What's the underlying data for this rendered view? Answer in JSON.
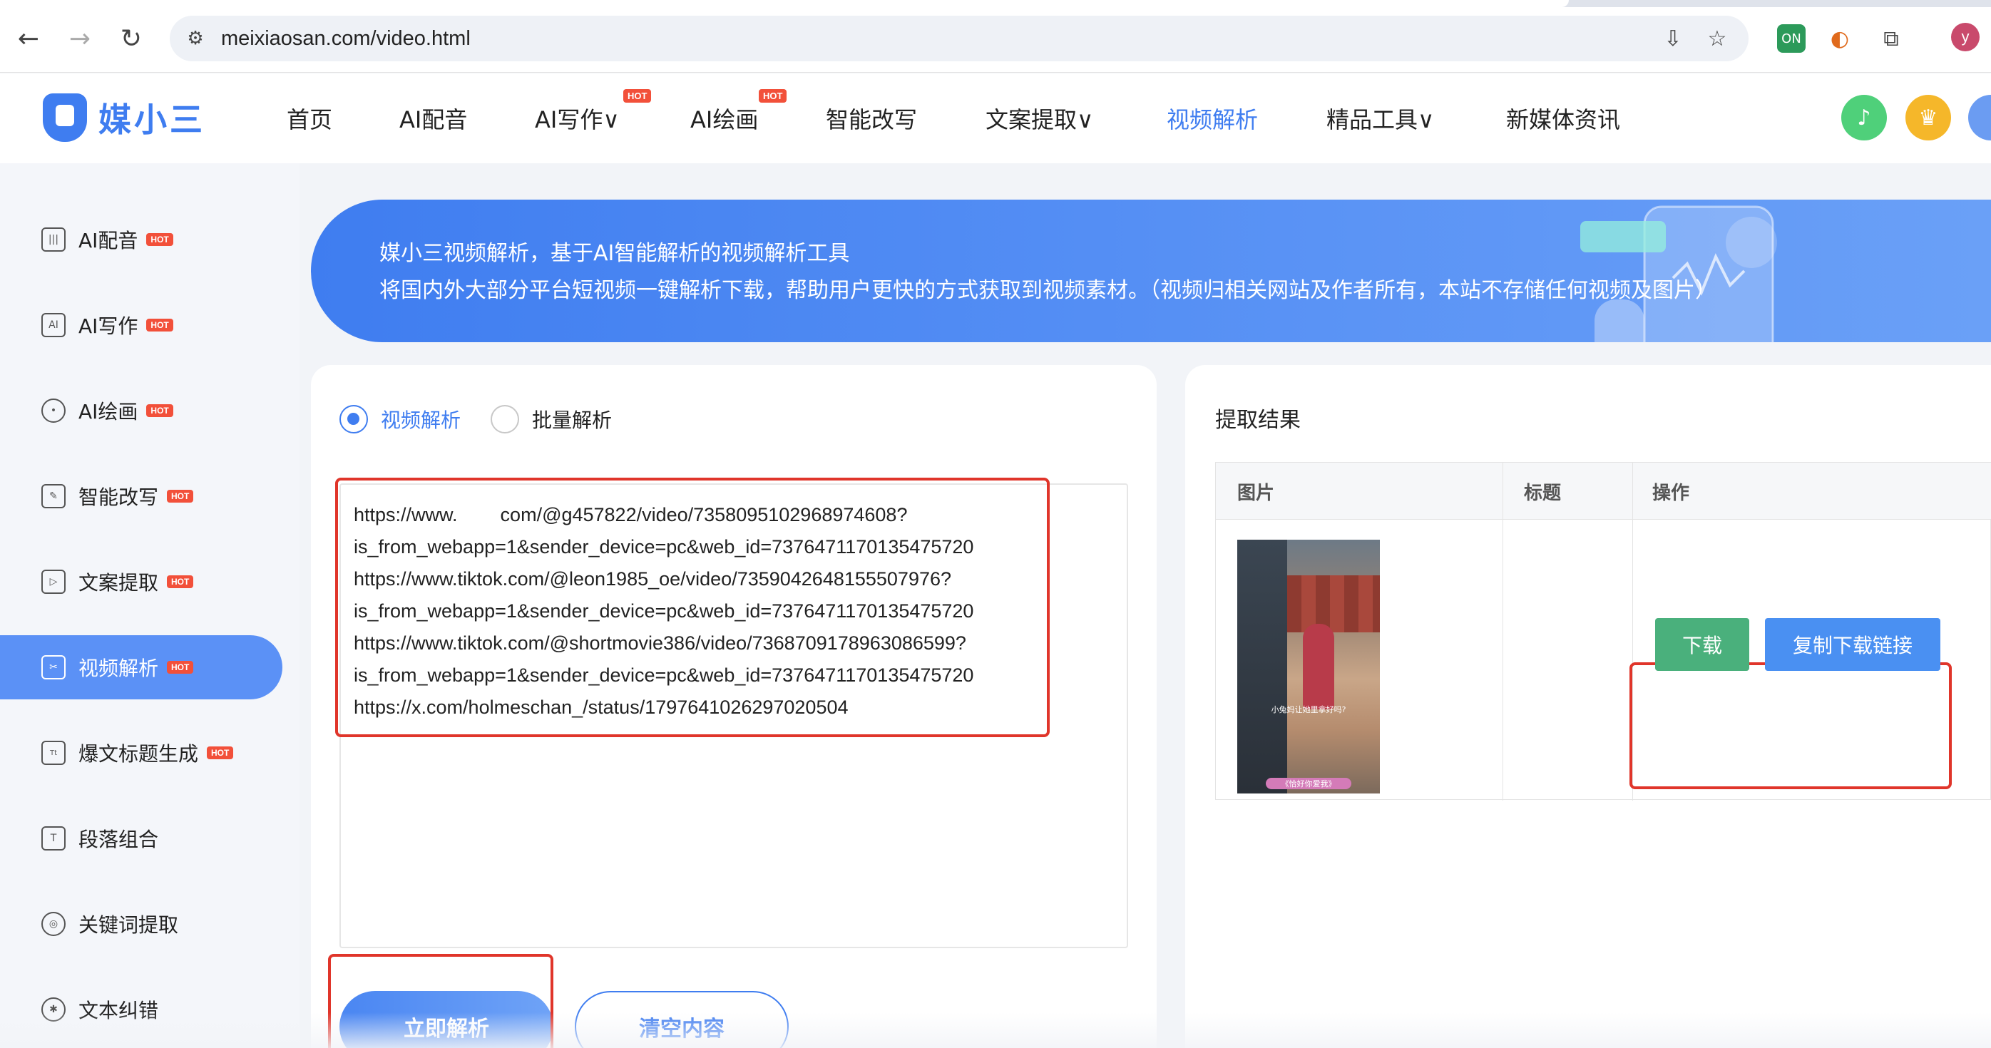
{
  "browser": {
    "url": "meixiaosan.com/video.html",
    "ext_badge": "ON",
    "profile_initial": "y"
  },
  "header": {
    "logo_text": "媒小三",
    "hot_label": "HOT",
    "menu": [
      {
        "label": "首页"
      },
      {
        "label": "AI配音"
      },
      {
        "label": "AI写作"
      },
      {
        "label": "AI绘画"
      },
      {
        "label": "智能改写"
      },
      {
        "label": "文案提取"
      },
      {
        "label": "视频解析"
      },
      {
        "label": "精品工具"
      },
      {
        "label": "新媒体资讯"
      }
    ],
    "chevron": "∨"
  },
  "sidebar": {
    "items": [
      {
        "label": "AI配音",
        "icon": "waveform-icon",
        "hot": true
      },
      {
        "label": "AI写作",
        "icon": "ai-write-icon",
        "hot": true
      },
      {
        "label": "AI绘画",
        "icon": "palette-icon",
        "hot": true
      },
      {
        "label": "智能改写",
        "icon": "edit-icon",
        "hot": true
      },
      {
        "label": "文案提取",
        "icon": "video-extract-icon",
        "hot": true
      },
      {
        "label": "视频解析",
        "icon": "video-parse-icon",
        "hot": true
      },
      {
        "label": "爆文标题生成",
        "icon": "title-icon",
        "hot": true
      },
      {
        "label": "段落组合",
        "icon": "text-box-icon",
        "hot": false
      },
      {
        "label": "关键词提取",
        "icon": "target-icon",
        "hot": false
      },
      {
        "label": "文本纠错",
        "icon": "bug-icon",
        "hot": false
      }
    ]
  },
  "banner": {
    "line1": "媒小三视频解析，基于AI智能解析的视频解析工具",
    "line2": "将国内外大部分平台短视频一键解析下载，帮助用户更快的方式获取到视频素材。（视频归相关网站及作者所有，本站不存储任何视频及图片）"
  },
  "form": {
    "mode_single": "视频解析",
    "mode_batch": "批量解析",
    "textarea_value": "https://www.        com/@g457822/video/7358095102968974608?\nis_from_webapp=1&sender_device=pc&web_id=7376471170135475720\nhttps://www.tiktok.com/@leon1985_oe/video/7359042648155507976?\nis_from_webapp=1&sender_device=pc&web_id=7376471170135475720\nhttps://www.tiktok.com/@shortmovie386/video/7368709178963086599?\nis_from_webapp=1&sender_device=pc&web_id=7376471170135475720\nhttps://x.com/holmeschan_/status/1797641026297020504",
    "parse_button": "立即解析",
    "clear_button": "清空内容"
  },
  "result": {
    "title": "提取结果",
    "columns": [
      "图片",
      "标题",
      "操作"
    ],
    "rows": [
      {
        "thumb_caption": "小兔妈让她里拿好吗?",
        "thumb_tag": "《恰好你爱我》",
        "title": "",
        "download_label": "下载",
        "copy_link_label": "复制下载链接"
      }
    ]
  },
  "colors": {
    "accent": "#3f7df0",
    "hot": "#f2503a",
    "highlight": "#e0352a",
    "download": "#4ab07c"
  }
}
